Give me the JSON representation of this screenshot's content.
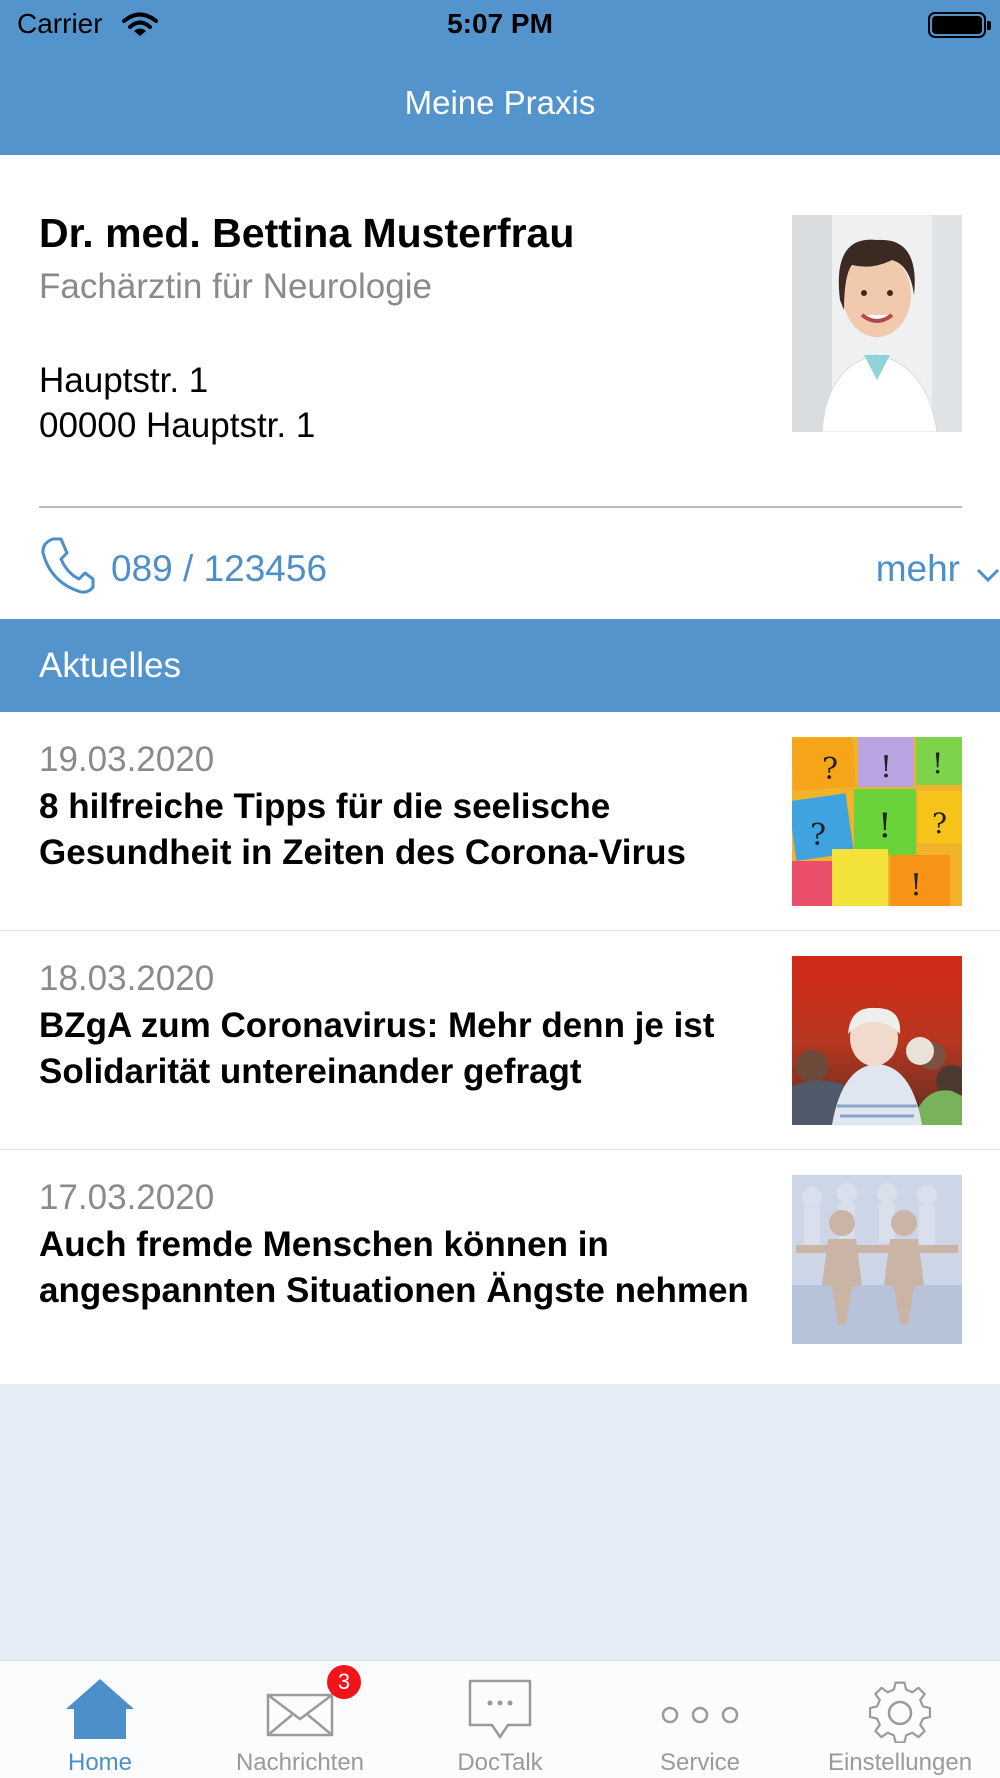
{
  "status_bar": {
    "carrier": "Carrier",
    "time": "5:07 PM"
  },
  "nav": {
    "title": "Meine Praxis"
  },
  "doctor": {
    "name": "Dr. med. Bettina Musterfrau",
    "specialty": "Fachärztin für Neurologie",
    "address_line1": "Hauptstr. 1",
    "address_line2": "00000 Hauptstr. 1",
    "phone": "089 / 123456",
    "more_label": "mehr"
  },
  "news_section": {
    "title": "Aktuelles",
    "items": [
      {
        "date": "19.03.2020",
        "title": "8 hilfreiche Tipps für die seelische Gesundheit in Zeiten des Corona-Virus",
        "image": "colorful-question-notes"
      },
      {
        "date": "18.03.2020",
        "title": "BZgA zum Coronavirus: Mehr denn je ist Solidarität untereinander gefragt",
        "image": "elderly-man-crowd"
      },
      {
        "date": "17.03.2020",
        "title": "Auch fremde Menschen können in angespannten Situationen Ängste nehmen",
        "image": "paper-people-circle"
      }
    ]
  },
  "tabbar": {
    "tabs": [
      {
        "label": "Home",
        "icon": "house-icon",
        "active": true
      },
      {
        "label": "Nachrichten",
        "icon": "envelope-icon",
        "badge": "3"
      },
      {
        "label": "DocTalk",
        "icon": "chat-bubble-icon"
      },
      {
        "label": "Service",
        "icon": "dots-icon"
      },
      {
        "label": "Einstellungen",
        "icon": "gear-icon"
      }
    ]
  },
  "colors": {
    "accent": "#5394cc",
    "link": "#4d8fca",
    "badge": "#f2141b",
    "background": "#e4ecf5"
  }
}
